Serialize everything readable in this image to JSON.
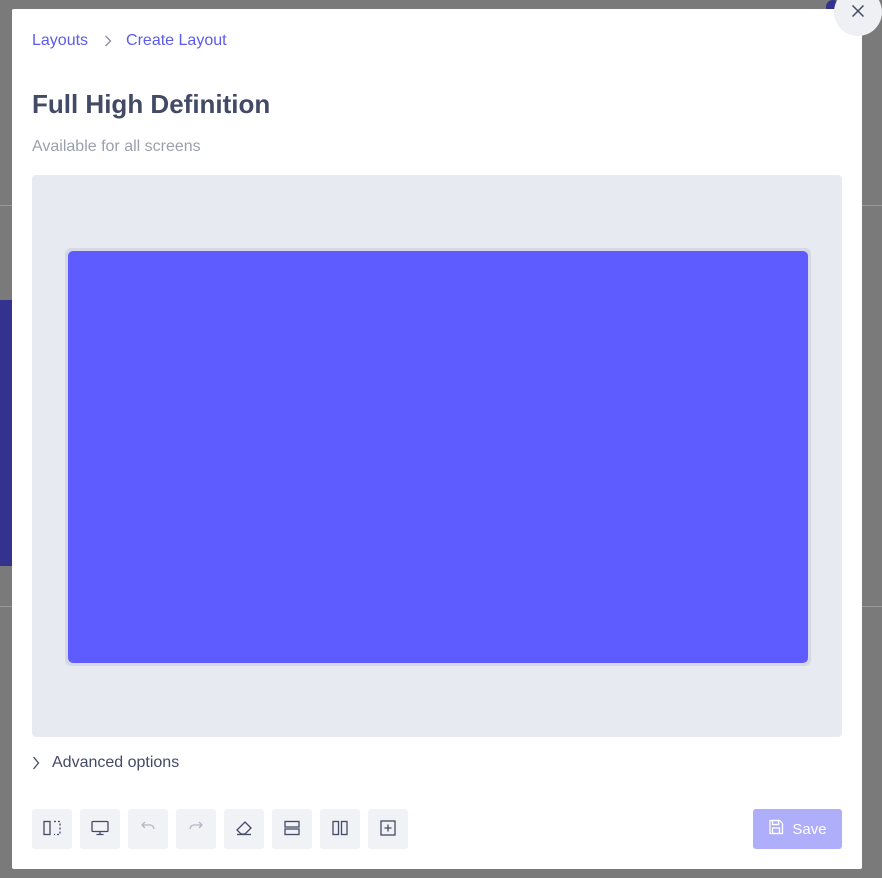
{
  "breadcrumb": {
    "items": [
      "Layouts",
      "Create Layout"
    ]
  },
  "title": "Full High Definition",
  "subtitle": "Available for all screens",
  "canvas": {
    "zone_color": "#5e5cff",
    "background": "#e8eaf2"
  },
  "advanced": {
    "label": "Advanced options"
  },
  "toolbar": {
    "tools": [
      {
        "icon": "split-vertical-icon",
        "enabled": true
      },
      {
        "icon": "monitor-icon",
        "enabled": true
      },
      {
        "icon": "undo-icon",
        "enabled": false
      },
      {
        "icon": "redo-icon",
        "enabled": false
      },
      {
        "icon": "eraser-icon",
        "enabled": true
      },
      {
        "icon": "rows-icon",
        "enabled": true
      },
      {
        "icon": "columns-icon",
        "enabled": true
      },
      {
        "icon": "add-zone-icon",
        "enabled": true
      }
    ]
  },
  "save": {
    "label": "Save",
    "icon": "floppy-disk-icon",
    "enabled": false
  },
  "colors": {
    "accent": "#5b5bf0",
    "save_disabled": "#afaefb",
    "title": "#434a66"
  }
}
